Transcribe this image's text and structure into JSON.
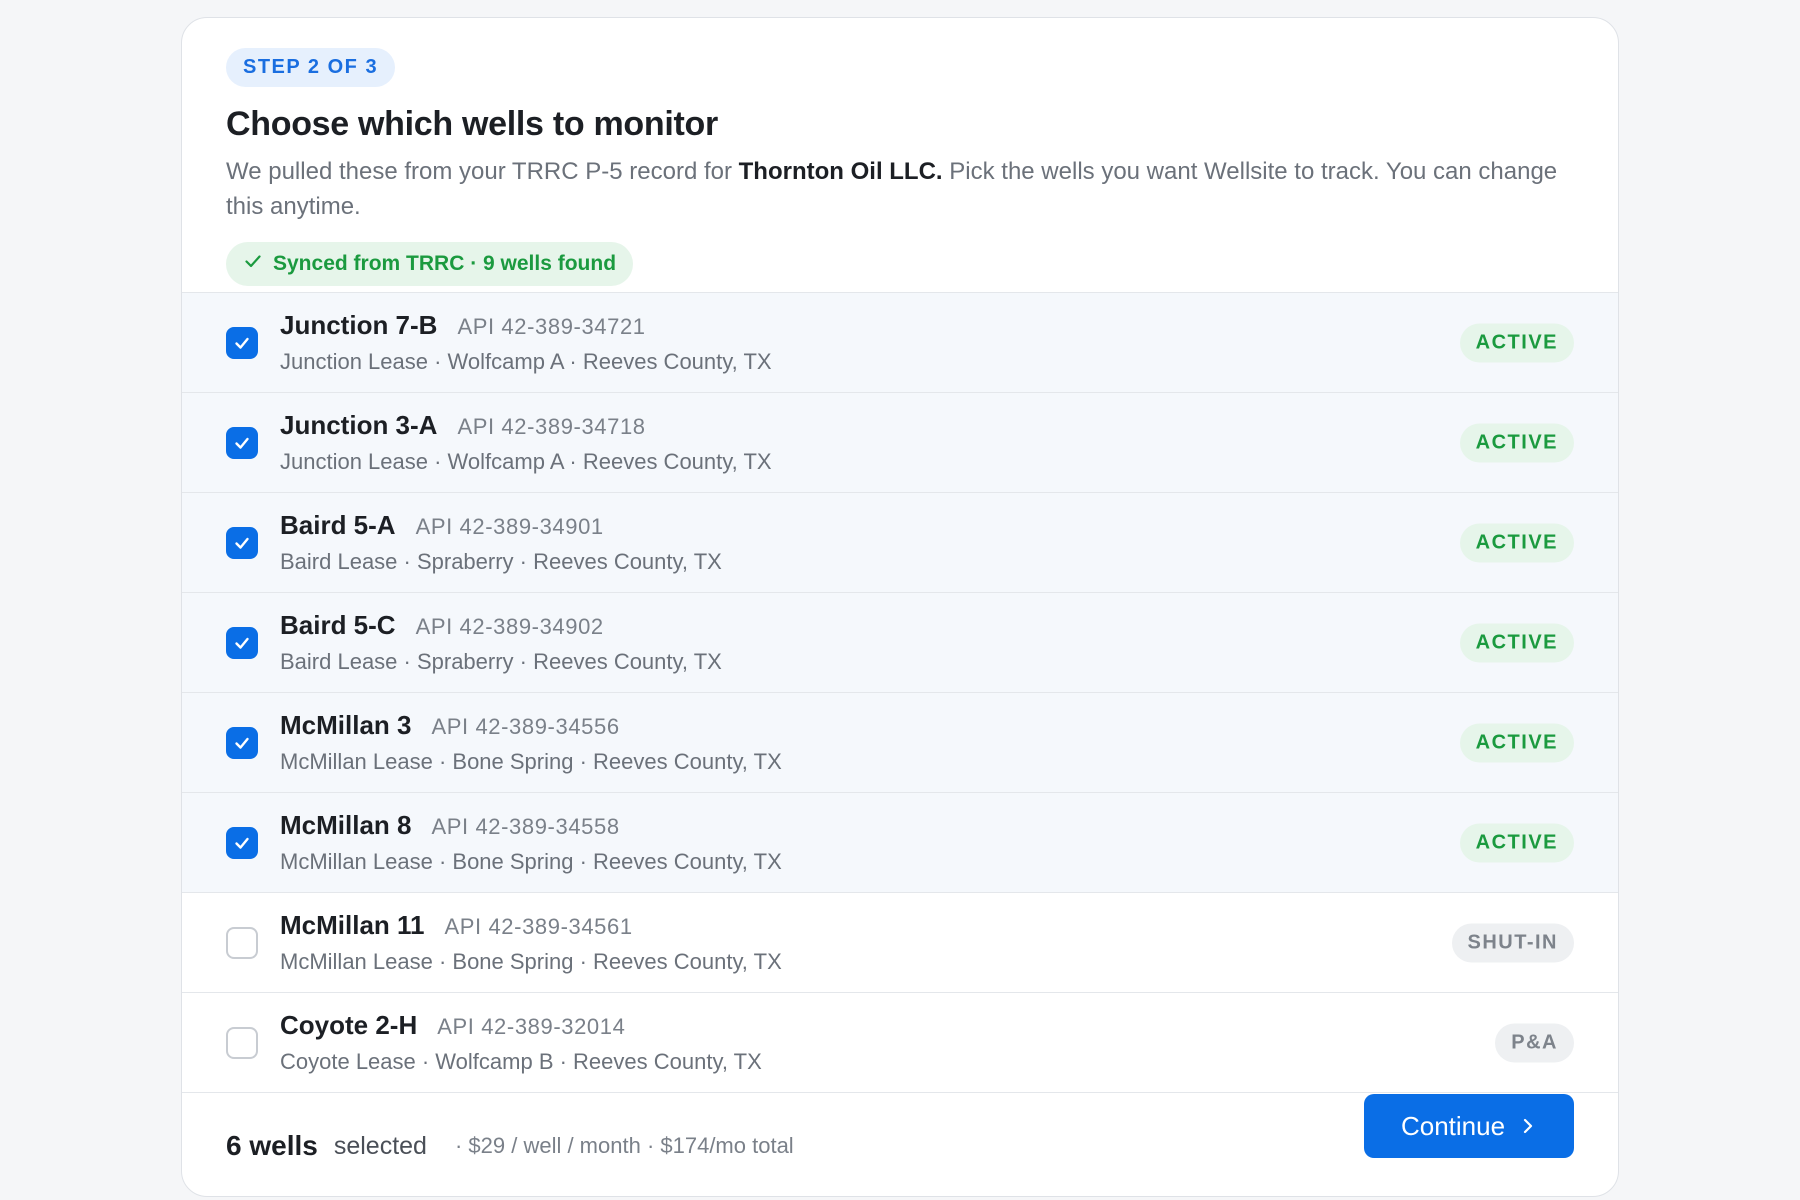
{
  "header": {
    "step": "STEP 2 OF 3",
    "title": "Choose which wells to monitor",
    "desc_before": "We pulled these from your TRRC P-5 record for",
    "operator": "Thornton Oil LLC.",
    "desc_after": "Pick the wells you want Wellsite to track. You can change this anytime.",
    "sync_status": "Synced from TRRC · 9 wells found",
    "sync_icon": "check-icon"
  },
  "wells": [
    {
      "name": "Junction 7-B",
      "api": "API 42-389-34721",
      "meta": "Junction Lease · Wolfcamp A · Reeves County, TX",
      "status": "ACTIVE",
      "checked": true
    },
    {
      "name": "Junction 3-A",
      "api": "API 42-389-34718",
      "meta": "Junction Lease · Wolfcamp A · Reeves County, TX",
      "status": "ACTIVE",
      "checked": true
    },
    {
      "name": "Baird 5-A",
      "api": "API 42-389-34901",
      "meta": "Baird Lease · Spraberry · Reeves County, TX",
      "status": "ACTIVE",
      "checked": true
    },
    {
      "name": "Baird 5-C",
      "api": "API 42-389-34902",
      "meta": "Baird Lease · Spraberry · Reeves County, TX",
      "status": "ACTIVE",
      "checked": true
    },
    {
      "name": "McMillan 3",
      "api": "API 42-389-34556",
      "meta": "McMillan Lease · Bone Spring · Reeves County, TX",
      "status": "ACTIVE",
      "checked": true
    },
    {
      "name": "McMillan 8",
      "api": "API 42-389-34558",
      "meta": "McMillan Lease · Bone Spring · Reeves County, TX",
      "status": "ACTIVE",
      "checked": true
    },
    {
      "name": "McMillan 11",
      "api": "API 42-389-34561",
      "meta": "McMillan Lease · Bone Spring · Reeves County, TX",
      "status": "SHUT-IN",
      "checked": false
    },
    {
      "name": "Coyote 2-H",
      "api": "API 42-389-32014",
      "meta": "Coyote Lease · Wolfcamp B · Reeves County, TX",
      "status": "P&A",
      "checked": false
    }
  ],
  "footer": {
    "count": "6 wells",
    "label": "selected",
    "pricing": "· $29 / well / month · $174/mo total",
    "continue_label": "Continue",
    "continue_icon": "chevron-right-icon"
  },
  "colors": {
    "accent": "#0a6ee6",
    "active_bg": "#e6f5ea",
    "active_text": "#1b9a3f",
    "muted_bg": "#eef0f2",
    "muted_text": "#7d838b"
  }
}
